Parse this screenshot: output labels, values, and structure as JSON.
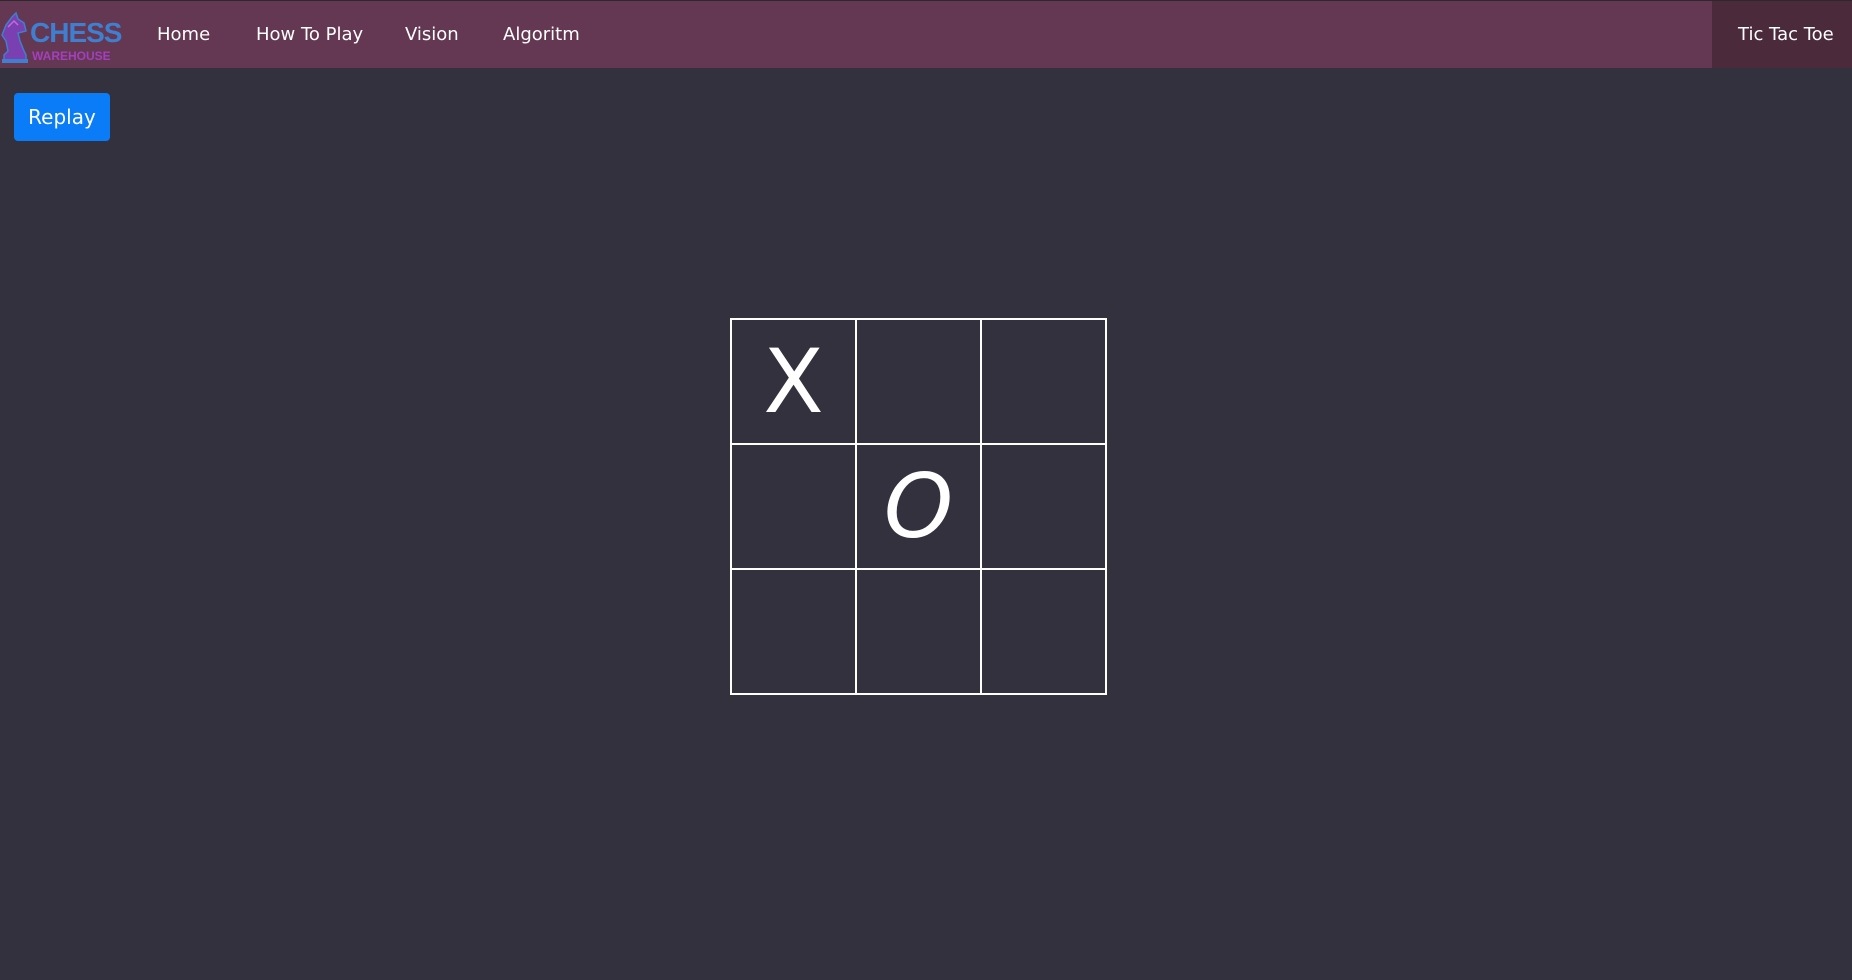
{
  "brand": {
    "title": "CHESS",
    "subtitle": "WAREHOUSE",
    "title_color": "#3f7fd0",
    "subtitle_color": "#a43fbf"
  },
  "nav": {
    "items": [
      {
        "label": "Home"
      },
      {
        "label": "How To Play"
      },
      {
        "label": "Vision"
      },
      {
        "label": "Algoritm"
      }
    ],
    "active": {
      "label": "Tic Tac Toe"
    }
  },
  "actions": {
    "replay_label": "Replay"
  },
  "board": {
    "cells": [
      {
        "value": "X"
      },
      {
        "value": ""
      },
      {
        "value": ""
      },
      {
        "value": ""
      },
      {
        "value": "O"
      },
      {
        "value": ""
      },
      {
        "value": ""
      },
      {
        "value": ""
      },
      {
        "value": ""
      }
    ]
  },
  "colors": {
    "navbar": "#643752",
    "navbar_active": "#4a2a3b",
    "background": "#33313d",
    "button": "#0a7cf7",
    "grid": "#ffffff"
  }
}
